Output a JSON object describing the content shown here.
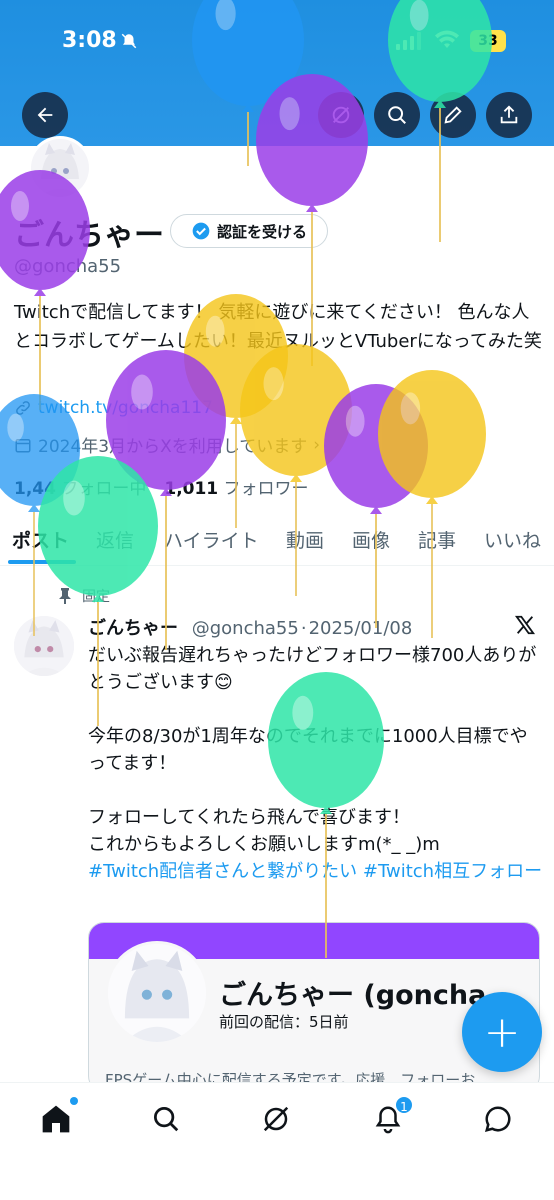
{
  "status_bar": {
    "time": "3:08",
    "battery": "33"
  },
  "profile": {
    "name": "ごんちゃー",
    "verify_label": "認証を受ける",
    "handle": "@goncha55",
    "bio": "Twitchで配信してます！ 気軽に遊びに来てください！ 色んな人とコラボしてゲームしたい！最近ヌルッとVTuberになってみた笑",
    "link": "twitch.tv/goncha117",
    "joined": "2024年3月からXを利用しています",
    "following_count": "1,44",
    "following_label": "フォロー中",
    "followers_count": "1,011",
    "followers_label": "フォロワー"
  },
  "tabs": [
    {
      "label": "ポスト"
    },
    {
      "label": "返信"
    },
    {
      "label": "ハイライト"
    },
    {
      "label": "動画"
    },
    {
      "label": "画像"
    },
    {
      "label": "記事"
    },
    {
      "label": "いいね"
    }
  ],
  "post": {
    "pinned_label": "固定",
    "author_name": "ごんちゃー",
    "author_handle": "@goncha55",
    "date": "2025/01/08",
    "line1": "だいぶ報告遅れちゃったけどフォロワー様700人ありがとうございます😊",
    "line2": "今年の8/30が1周年なのでそれまでに1000人目標でやってます！",
    "line3": "フォローしてくれたら飛んで喜びます！",
    "line4": "これからもよろしくお願いしますm(*_ _)m",
    "hashtags": "#Twitch配信者さんと繋がりたい #Twitch相互フォロー"
  },
  "card": {
    "title": "ごんちゃー (goncha...",
    "subtitle": "前回の配信：5日前",
    "description": "FPSゲーム中心に配信する予定です。応援、フォローお"
  },
  "nav": {
    "notification_count": "1"
  },
  "colors": {
    "accent": "#1d9bf0",
    "banner": "#1f8fe0",
    "card_header": "#9146ff"
  }
}
